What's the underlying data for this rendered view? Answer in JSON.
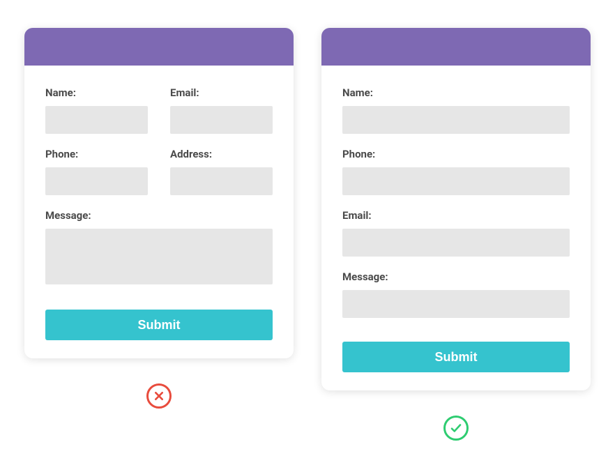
{
  "colors": {
    "header": "#7E69B3",
    "input_bg": "#E6E6E6",
    "submit_bg": "#35C3CE",
    "label_color": "#4A4A4A",
    "bad_icon": "#E84C3D",
    "good_icon": "#2ECC71"
  },
  "bad_example": {
    "fields": {
      "name_label": "Name:",
      "email_label": "Email:",
      "phone_label": "Phone:",
      "address_label": "Address:",
      "message_label": "Message:"
    },
    "submit_label": "Submit",
    "status": "cross-icon"
  },
  "good_example": {
    "fields": {
      "name_label": "Name:",
      "phone_label": "Phone:",
      "email_label": "Email:",
      "message_label": "Message:"
    },
    "submit_label": "Submit",
    "status": "check-icon"
  }
}
